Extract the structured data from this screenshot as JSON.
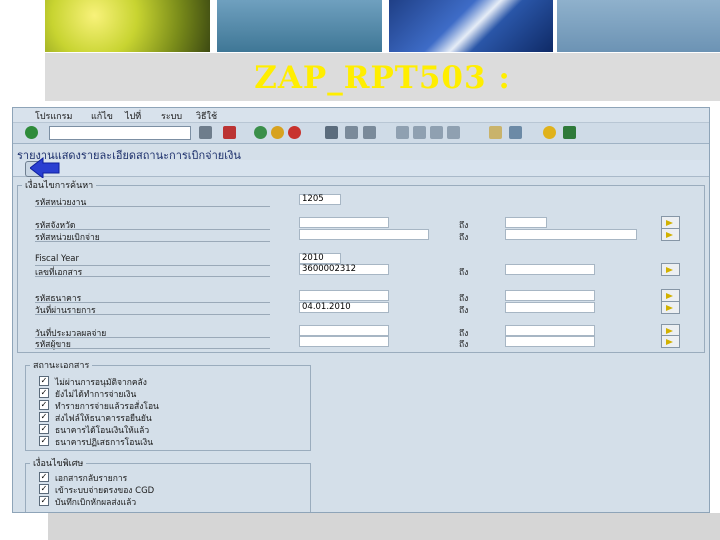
{
  "slide": {
    "title": "ZAP_RPT503 :"
  },
  "sap": {
    "menu": [
      "โปรแกรม",
      "แก้ไข",
      "ไปที่",
      "ระบบ",
      "วิธีใช้"
    ],
    "command_field": "",
    "report_title": "รายงานแสดงรายละเอียดสถานะการเบิกจ่ายเงิน",
    "ding_label": "ถึง",
    "selection": {
      "group_title": "เงื่อนไขการค้นหา",
      "fields": [
        {
          "label": "รหัสหน่วยงาน",
          "from": "1205",
          "has_to": false,
          "more": false
        },
        {
          "label": "รหัสจังหวัด",
          "from": "",
          "has_to": true,
          "more": true
        },
        {
          "label": "รหัสหน่วยเบิกจ่าย",
          "from": "",
          "has_to": true,
          "more": true
        },
        {
          "label": "Fiscal Year",
          "from": "2010",
          "has_to": false,
          "more": false
        },
        {
          "label": "เลขที่เอกสาร",
          "from": "3600002312",
          "has_to": true,
          "more": true
        },
        {
          "label": "รหัสธนาคาร",
          "from": "",
          "has_to": true,
          "more": true
        },
        {
          "label": "วันที่ผ่านรายการ",
          "from": "04.01.2010",
          "has_to": true,
          "more": true
        },
        {
          "label": "วันที่ประมวลผลจ่าย",
          "from": "",
          "has_to": true,
          "more": true
        },
        {
          "label": "รหัสผู้ขาย",
          "from": "",
          "has_to": true,
          "more": true
        }
      ]
    },
    "status_group": {
      "title": "สถานะเอกสาร",
      "items": [
        {
          "label": "ไม่ผ่านการอนุมัติจากคลัง",
          "checked": true
        },
        {
          "label": "ยังไม่ได้ทำการจ่ายเงิน",
          "checked": true
        },
        {
          "label": "ทำรายการจ่ายแล้วรอสั่งโอน",
          "checked": true
        },
        {
          "label": "ส่งไฟล์ให้ธนาคารรอยืนยัน",
          "checked": true
        },
        {
          "label": "ธนาคารได้โอนเงินให้แล้ว",
          "checked": true
        },
        {
          "label": "ธนาคารปฏิเสธการโอนเงิน",
          "checked": true
        }
      ]
    },
    "special_group": {
      "title": "เงื่อนไขพิเศษ",
      "items": [
        {
          "label": "เอกสารกลับรายการ",
          "checked": true
        },
        {
          "label": "เข้าระบบจ่ายตรงของ CGD",
          "checked": true
        },
        {
          "label": "บันทึกเบิกหักผลส่งแล้ว",
          "checked": true
        }
      ]
    },
    "colors": {
      "accent": "#2a3fd1",
      "title": "#ffee00",
      "panel": "#d4dfe9"
    },
    "icons": [
      "checkmark-icon",
      "back-icon",
      "exit-icon",
      "cancel-icon",
      "print-icon",
      "find-icon",
      "page-nav-icon",
      "new-session-icon",
      "shortcut-icon",
      "help-icon",
      "layout-icon",
      "execute-icon"
    ]
  }
}
